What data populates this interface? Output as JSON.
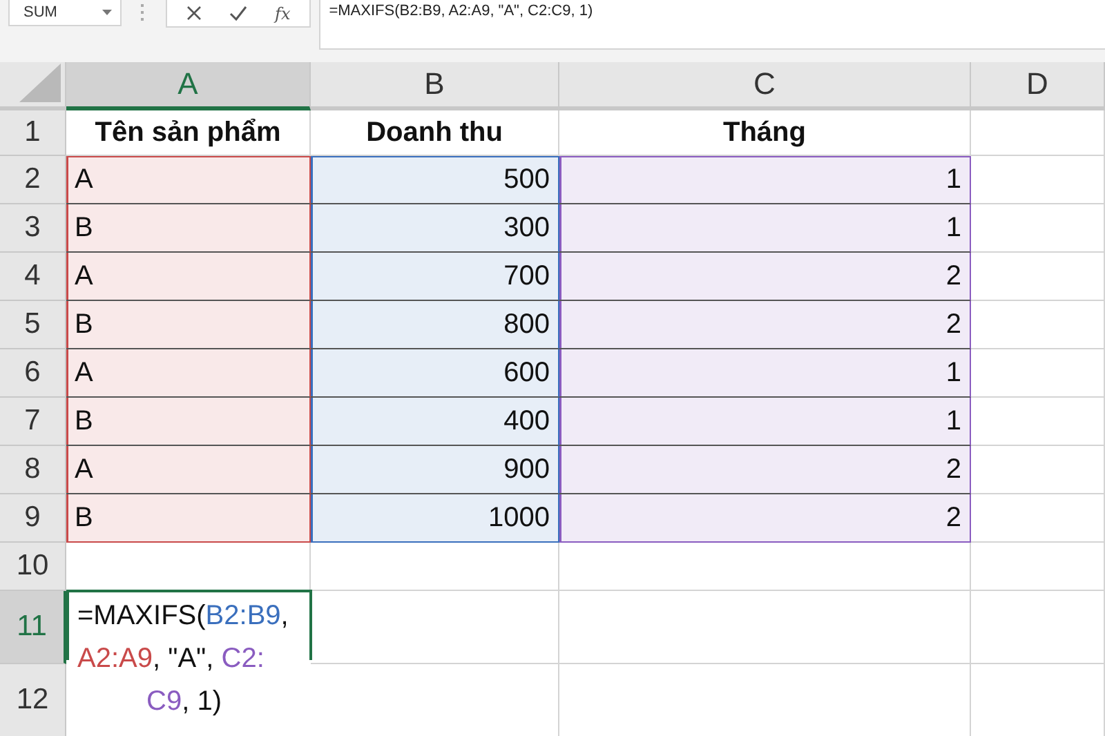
{
  "formula_bar": {
    "name_box": "SUM",
    "function_label": "fx",
    "formula": "=MAXIFS(B2:B9, A2:A9, \"A\", C2:C9, 1)"
  },
  "columns": [
    {
      "label": "A",
      "selected": true
    },
    {
      "label": "B",
      "selected": false
    },
    {
      "label": "C",
      "selected": false
    },
    {
      "label": "D",
      "selected": false
    }
  ],
  "rows": [
    {
      "number": "1",
      "selected": false,
      "cells": [
        {
          "kind": "header",
          "text": "Tên sản phẩm"
        },
        {
          "kind": "header",
          "text": "Doanh thu"
        },
        {
          "kind": "header",
          "text": "Tháng"
        }
      ]
    },
    {
      "number": "2",
      "selected": false,
      "cells": [
        {
          "kind": "text",
          "text": "A",
          "color": "#c94a4a"
        },
        {
          "kind": "number",
          "text": "500",
          "color": "#3a6fbd"
        },
        {
          "kind": "number",
          "text": "1",
          "color": "#8a5cc0"
        }
      ]
    },
    {
      "number": "3",
      "selected": false,
      "cells": [
        {
          "kind": "text",
          "text": "B",
          "color": "#c94a4a"
        },
        {
          "kind": "number",
          "text": "300",
          "color": "#3a6fbd"
        },
        {
          "kind": "number",
          "text": "1",
          "color": "#8a5cc0"
        }
      ]
    },
    {
      "number": "4",
      "selected": false,
      "cells": [
        {
          "kind": "text",
          "text": "A",
          "color": "#c94a4a"
        },
        {
          "kind": "number",
          "text": "700",
          "color": "#3a6fbd"
        },
        {
          "kind": "number",
          "text": "2",
          "color": "#8a5cc0"
        }
      ]
    },
    {
      "number": "5",
      "selected": false,
      "cells": [
        {
          "kind": "text",
          "text": "B",
          "color": "#c94a4a"
        },
        {
          "kind": "number",
          "text": "800",
          "color": "#3a6fbd"
        },
        {
          "kind": "number",
          "text": "2",
          "color": "#8a5cc0"
        }
      ]
    },
    {
      "number": "6",
      "selected": false,
      "cells": [
        {
          "kind": "text",
          "text": "A",
          "color": "#c94a4a"
        },
        {
          "kind": "number",
          "text": "600",
          "color": "#3a6fbd"
        },
        {
          "kind": "number",
          "text": "1",
          "color": "#8a5cc0"
        }
      ]
    },
    {
      "number": "7",
      "selected": false,
      "cells": [
        {
          "kind": "text",
          "text": "B",
          "color": "#c94a4a"
        },
        {
          "kind": "number",
          "text": "400",
          "color": "#3a6fbd"
        },
        {
          "kind": "number",
          "text": "1",
          "color": "#8a5cc0"
        }
      ]
    },
    {
      "number": "8",
      "selected": false,
      "cells": [
        {
          "kind": "text",
          "text": "A",
          "color": "#c94a4a"
        },
        {
          "kind": "number",
          "text": "900",
          "color": "#3a6fbd"
        },
        {
          "kind": "number",
          "text": "2",
          "color": "#8a5cc0"
        }
      ]
    },
    {
      "number": "9",
      "selected": false,
      "cells": [
        {
          "kind": "text",
          "text": "B",
          "color": "#c94a4a"
        },
        {
          "kind": "number",
          "text": "1000",
          "color": "#3a6fbd"
        },
        {
          "kind": "number",
          "text": "2",
          "color": "#8a5cc0"
        }
      ]
    },
    {
      "number": "10",
      "selected": false
    },
    {
      "number": "11",
      "selected": true,
      "cells": [
        {
          "kind": "formula",
          "lines": [
            [
              {
                "text": "=MAXIFS("
              },
              {
                "text": "B2:B9",
                "color": "#3a6fbd"
              },
              {
                "text": ","
              }
            ],
            [
              {
                "text": "A2:A9",
                "color": "#c94a4a"
              },
              {
                "text": ", \"A\", "
              },
              {
                "text": "C2:",
                "color": "#8a5cc0"
              }
            ],
            [
              {
                "text": "C9",
                "color": "#8a5cc0"
              },
              {
                "text": ", 1)"
              }
            ]
          ]
        }
      ]
    },
    {
      "number": "12",
      "selected": false
    }
  ]
}
